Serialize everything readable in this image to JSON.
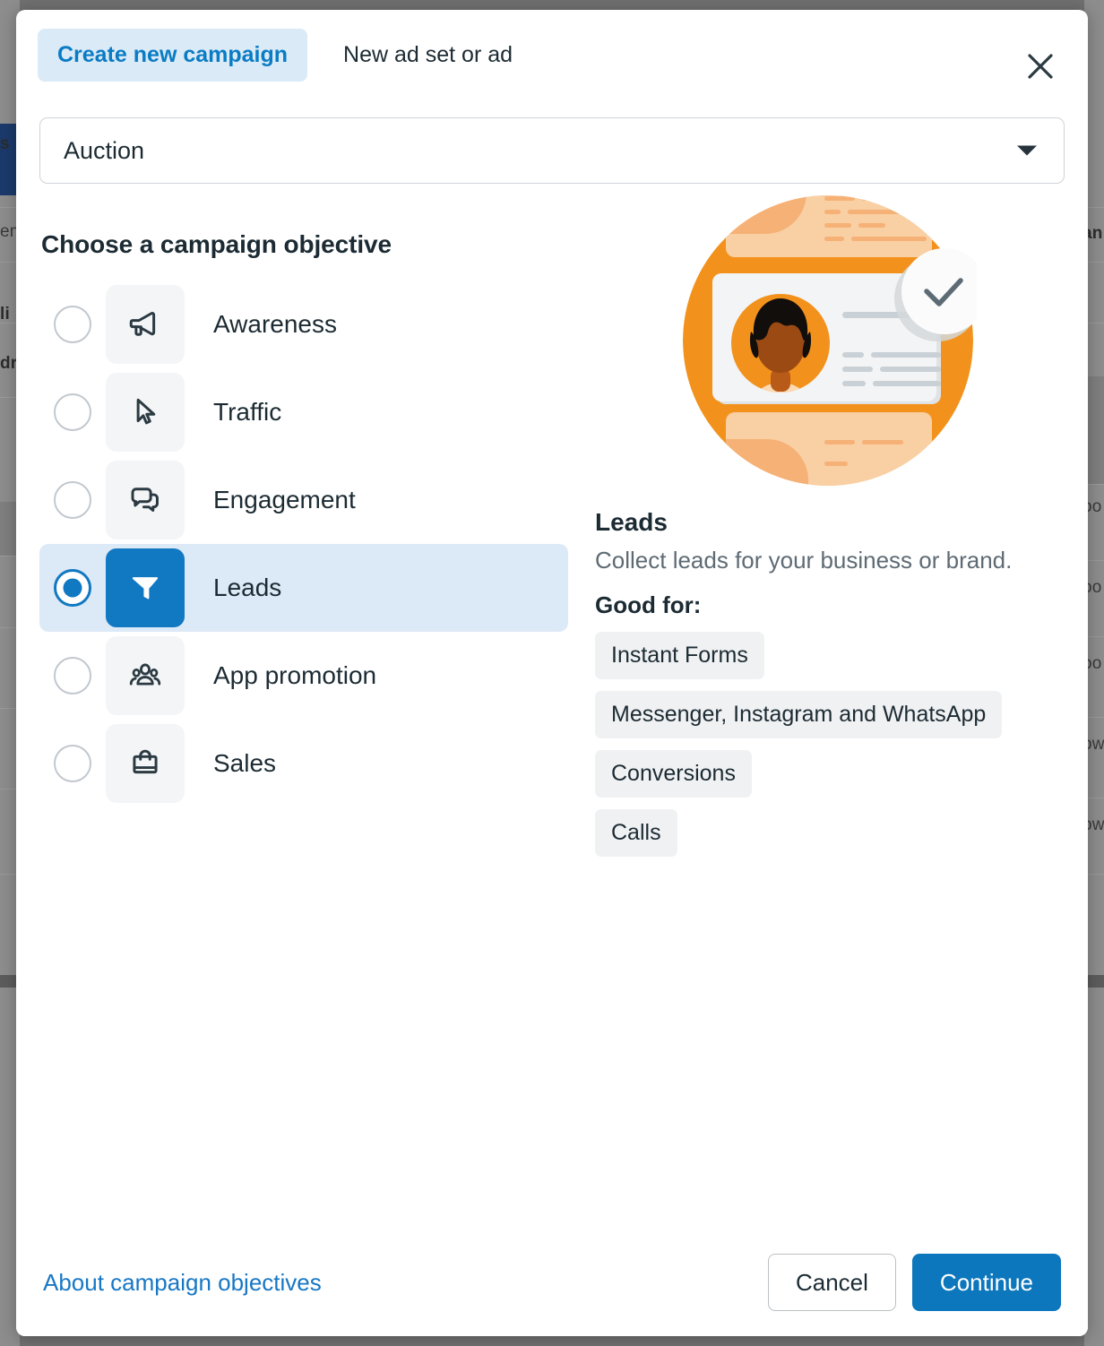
{
  "background": {
    "left_texts": [
      "s",
      "en",
      "li",
      "dr"
    ],
    "right_texts": [
      "an",
      "oo",
      "oo",
      "oo",
      "ow",
      "ow"
    ]
  },
  "modal": {
    "tabs": [
      {
        "label": "Create new campaign",
        "active": true
      },
      {
        "label": "New ad set or ad",
        "active": false
      }
    ],
    "close_icon": "close-icon",
    "buying_type": {
      "value": "Auction",
      "caret_icon": "chevron-down-icon"
    },
    "objective_section": {
      "title": "Choose a campaign objective",
      "options": [
        {
          "label": "Awareness",
          "icon": "megaphone-icon",
          "selected": false
        },
        {
          "label": "Traffic",
          "icon": "cursor-icon",
          "selected": false
        },
        {
          "label": "Engagement",
          "icon": "chat-bubbles-icon",
          "selected": false
        },
        {
          "label": "Leads",
          "icon": "funnel-icon",
          "selected": true
        },
        {
          "label": "App promotion",
          "icon": "people-group-icon",
          "selected": false
        },
        {
          "label": "Sales",
          "icon": "shopping-bag-icon",
          "selected": false
        }
      ]
    },
    "detail": {
      "illustration": "lead-form-illustration",
      "title": "Leads",
      "description": "Collect leads for your business or brand.",
      "good_for_label": "Good for:",
      "tags": [
        "Instant Forms",
        "Messenger, Instagram and WhatsApp",
        "Conversions",
        "Calls"
      ]
    },
    "footer": {
      "about_link": "About campaign objectives",
      "cancel_label": "Cancel",
      "continue_label": "Continue"
    }
  },
  "colors": {
    "accent_blue": "#0c77bd",
    "tab_active_bg": "#dbeaf7",
    "tab_active_text": "#0a7cc4",
    "selected_row_bg": "#dce9f6",
    "icon_tile_bg": "#f4f5f6",
    "tag_bg": "#f0f1f3",
    "text_primary": "#1c2b33",
    "text_muted": "#5e6b74",
    "illustration_orange": "#f2921d"
  }
}
